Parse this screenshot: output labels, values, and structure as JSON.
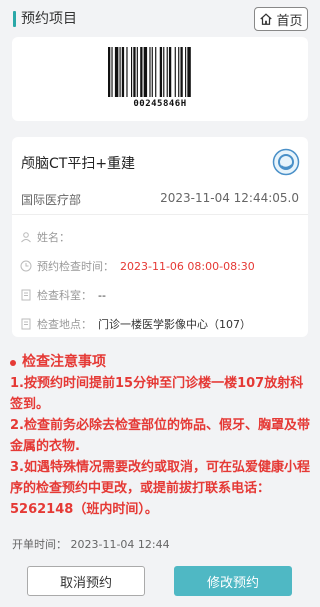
{
  "header": {
    "title": "预约项目",
    "home_label": "首页"
  },
  "barcode": {
    "number": "00245846H"
  },
  "exam": {
    "name": "颅脑CT平扫+重建",
    "department": "国际医疗部",
    "created_time": "2023-11-04 12:44:05.0",
    "fields": [
      {
        "label": "姓名：",
        "value": ""
      },
      {
        "label": "预约检查时间：",
        "value": "2023-11-06 08:00-08:30"
      },
      {
        "label": "检查科室：",
        "value": "--"
      },
      {
        "label": "检查地点：",
        "value": "门诊一楼医学影像中心（107）"
      }
    ]
  },
  "notice": {
    "title": "检查注意事项",
    "items": [
      "1.按预约时间提前15分钟至门诊楼一楼107放射科签到。",
      "2.检查前务必除去检查部位的饰品、假牙、胸罩及带金属的衣物.",
      "3.如遇特殊情况需要改约或取消，可在弘爱健康小程序的检查预约中更改，或提前拔打联系电话：5262148（班内时间）。"
    ]
  },
  "footer": {
    "open_time_label": "开单时间：",
    "open_time": "2023-11-04 12:44",
    "cancel_label": "取消预约",
    "modify_label": "修改预约"
  },
  "colors": {
    "accent": "#4fb8c4",
    "warning": "#e53935",
    "header_bar": "#2aa8a8"
  },
  "icons": [
    "home-icon",
    "scan-icon",
    "user-icon",
    "clock-icon",
    "document-icon"
  ]
}
